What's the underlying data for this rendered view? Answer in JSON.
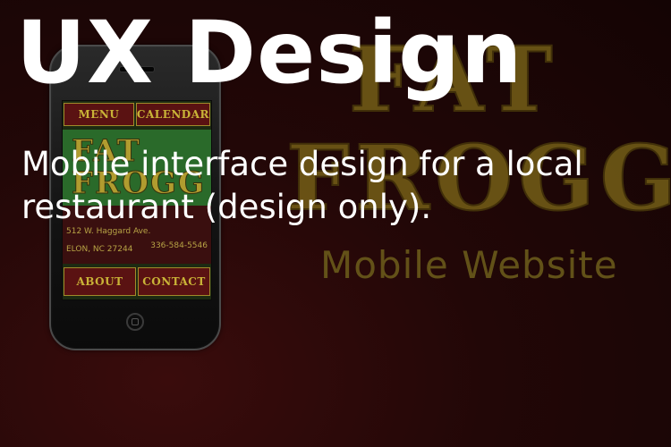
{
  "headline": "UX Design",
  "description": "Mobile interface design for a local restaurant (design only).",
  "background_logo": {
    "line1": "FAT",
    "line2": "FROGG",
    "subtitle": "Mobile Website"
  },
  "phone_screen": {
    "top_tabs": [
      "MENU",
      "CALENDAR"
    ],
    "logo_line1": "FAT",
    "logo_line2": "FROGG",
    "address": "512 W. Haggard Ave.",
    "city": "ELON, NC 27244",
    "phone": "336-584-5546",
    "bottom_tabs": [
      "ABOUT",
      "CONTACT"
    ]
  },
  "colors": {
    "background": "#220707",
    "text": "#ffffff",
    "logo_gold": "#7a6418",
    "tab_gold": "#c9b337",
    "tab_red": "#5a1212",
    "screen_green": "#2a6a2a"
  }
}
